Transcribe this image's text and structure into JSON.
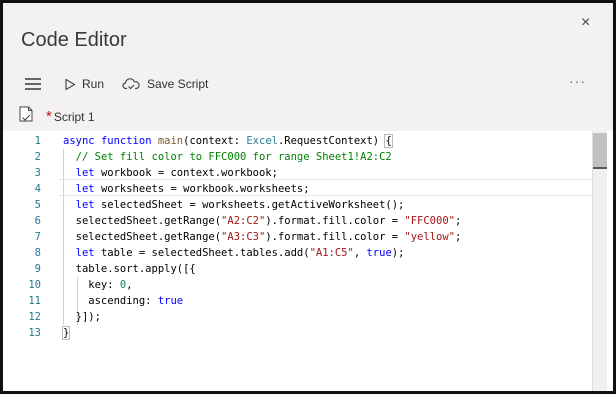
{
  "window": {
    "title": "Code Editor",
    "close_glyph": "×"
  },
  "toolbar": {
    "menu_icon": "hamburger-icon",
    "run_label": "Run",
    "run_icon": "play-icon",
    "save_label": "Save Script",
    "save_icon": "cloud-save-icon",
    "more_glyph": "···"
  },
  "tab": {
    "modified_marker": "*",
    "label": "Script 1",
    "icon": "script-file-icon"
  },
  "editor": {
    "line_numbers": [
      "1",
      "2",
      "3",
      "4",
      "5",
      "6",
      "7",
      "8",
      "9",
      "10",
      "11",
      "12",
      "13"
    ],
    "lines": [
      [
        [
          "kw",
          "async"
        ],
        [
          "",
          " "
        ],
        [
          "kw",
          "function"
        ],
        [
          "",
          " "
        ],
        [
          "fn",
          "main"
        ],
        [
          "",
          "(context: "
        ],
        [
          "ty",
          "Excel"
        ],
        [
          "",
          ".RequestContext) "
        ],
        [
          "bm",
          "{"
        ]
      ],
      [
        [
          "",
          "  "
        ],
        [
          "cm",
          "// Set fill color to FFC000 for range Sheet1!A2:C2"
        ]
      ],
      [
        [
          "",
          "  "
        ],
        [
          "kw",
          "let"
        ],
        [
          "",
          ""
        ],
        [
          "",
          ""
        ],
        [
          "",
          " workbook = context.workbook;"
        ]
      ],
      [
        [
          "",
          "  "
        ],
        [
          "kw",
          "let"
        ],
        [
          "",
          " worksheets = workbook.worksheets;"
        ]
      ],
      [
        [
          "",
          "  "
        ],
        [
          "kw",
          "let"
        ],
        [
          "",
          " selectedSheet = worksheets.getActiveWorksheet();"
        ]
      ],
      [
        [
          "",
          "  selectedSheet.getRange("
        ],
        [
          "str",
          "\"A2:C2\""
        ],
        [
          "",
          ").format.fill.color = "
        ],
        [
          "str",
          "\"FFC000\""
        ],
        [
          "",
          ";"
        ]
      ],
      [
        [
          "",
          "  selectedSheet.getRange("
        ],
        [
          "str",
          "\"A3:C3\""
        ],
        [
          "",
          ").format.fill.color = "
        ],
        [
          "str",
          "\"yellow\""
        ],
        [
          "",
          ";"
        ]
      ],
      [
        [
          "",
          "  "
        ],
        [
          "kw",
          "let"
        ],
        [
          "",
          " table = selectedSheet.tables.add("
        ],
        [
          "str",
          "\"A1:C5\""
        ],
        [
          "",
          ", "
        ],
        [
          "kw",
          "true"
        ],
        [
          "",
          ");"
        ]
      ],
      [
        [
          "",
          "  table.sort.apply([{"
        ]
      ],
      [
        [
          "",
          "    key: "
        ],
        [
          "num",
          "0"
        ],
        [
          "",
          ","
        ]
      ],
      [
        [
          "",
          "    ascending: "
        ],
        [
          "kw",
          "true"
        ]
      ],
      [
        [
          "",
          "  }]);"
        ]
      ],
      [
        [
          "bm",
          "}"
        ]
      ]
    ]
  },
  "colors": {
    "header_bg": "#f3f2f1",
    "keyword": "#0000ff",
    "comment": "#008000",
    "string": "#a31515",
    "number": "#098658",
    "line_number": "#237893",
    "modified_marker": "#c50f1f"
  }
}
